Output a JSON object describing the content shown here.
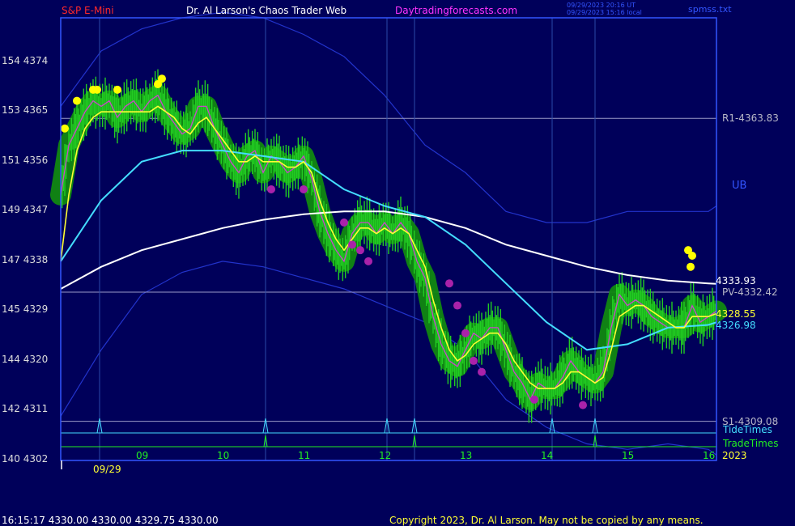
{
  "header": {
    "instrument": "S&P E-Mini",
    "site": "Dr. Al Larson's Chaos Trader Web",
    "url": "Daytradingforecasts.com",
    "stamp_utc": "09/29/2023 20:16 UT",
    "stamp_local": "09/29/2023 15:16 local",
    "file": "spmss.txt"
  },
  "colors": {
    "background": "#00005a",
    "plot_border": "#3355ff",
    "price_bars": "#22cc22",
    "glow": "#118811",
    "fast_avg": "#ffff33",
    "mid_avg": "#44ddff",
    "slow_avg": "#ffffff",
    "bands": "#2233cc",
    "dots_high": "#ffff00",
    "dots_low": "#aa22aa"
  },
  "chart_data": {
    "type": "line",
    "x_label_ticks": [
      "09",
      "10",
      "11",
      "12",
      "13",
      "14",
      "15",
      "16"
    ],
    "x_label_positions_hours": [
      9,
      10,
      11,
      12,
      13,
      14,
      15,
      16
    ],
    "date_label": "09/29",
    "year_label": "2023",
    "xlim": [
      8.0,
      16.1
    ],
    "ylim": [
      4302,
      4382
    ],
    "y_ticks": [
      {
        "label": "154  4374",
        "value": 4374
      },
      {
        "label": "153  4365",
        "value": 4365
      },
      {
        "label": "151  4356",
        "value": 4356
      },
      {
        "label": "149  4347",
        "value": 4347
      },
      {
        "label": "147  4338",
        "value": 4338
      },
      {
        "label": "145  4329",
        "value": 4329
      },
      {
        "label": "144  4320",
        "value": 4320
      },
      {
        "label": "142  4311",
        "value": 4311
      },
      {
        "label": "140  4302",
        "value": 4302
      }
    ],
    "levels": [
      {
        "label": "R1-4363.83",
        "value": 4363.83,
        "color": "#9a9ac8"
      },
      {
        "label": "PV-4332.42",
        "value": 4332.42,
        "color": "#9a9ac8"
      },
      {
        "label": "S1-4309.08",
        "value": 4309.08,
        "color": "#9a9ac8"
      }
    ],
    "band_label": "UB",
    "end_labels": [
      {
        "label": "4333.93",
        "value": 4333.93,
        "color": "#ffffff"
      },
      {
        "label": "4328.55",
        "value": 4328.55,
        "color": "#ffff33"
      },
      {
        "label": "4326.98",
        "value": 4326.98,
        "color": "#44ddff"
      }
    ],
    "price": {
      "name": "",
      "x": [
        8.0,
        8.1,
        8.2,
        8.3,
        8.4,
        8.5,
        8.6,
        8.7,
        8.8,
        8.9,
        9.0,
        9.1,
        9.2,
        9.3,
        9.4,
        9.5,
        9.6,
        9.7,
        9.8,
        9.9,
        10.0,
        10.1,
        10.2,
        10.3,
        10.4,
        10.5,
        10.6,
        10.7,
        10.8,
        10.9,
        11.0,
        11.1,
        11.2,
        11.3,
        11.4,
        11.5,
        11.6,
        11.7,
        11.8,
        11.9,
        12.0,
        12.1,
        12.2,
        12.3,
        12.4,
        12.5,
        12.6,
        12.7,
        12.8,
        12.9,
        13.0,
        13.1,
        13.2,
        13.3,
        13.4,
        13.5,
        13.6,
        13.7,
        13.8,
        13.9,
        14.0,
        14.1,
        14.2,
        14.3,
        14.4,
        14.5,
        14.6,
        14.7,
        14.8,
        14.9,
        15.0,
        15.1,
        15.2,
        15.3,
        15.4,
        15.5,
        15.6,
        15.7,
        15.8,
        15.9,
        16.0,
        16.1
      ],
      "y": [
        4350,
        4359,
        4362,
        4365,
        4367,
        4366,
        4367,
        4364,
        4366,
        4367,
        4365,
        4367,
        4368,
        4365,
        4363,
        4361,
        4362,
        4366,
        4366,
        4362,
        4359,
        4356,
        4354,
        4357,
        4358,
        4354,
        4357,
        4356,
        4354,
        4355,
        4357,
        4353,
        4347,
        4343,
        4340,
        4338,
        4343,
        4345,
        4345,
        4343,
        4345,
        4343,
        4345,
        4343,
        4338,
        4335,
        4328,
        4323,
        4320,
        4319,
        4322,
        4325,
        4324,
        4326,
        4326,
        4322,
        4318,
        4316,
        4313,
        4316,
        4315,
        4315,
        4317,
        4320,
        4318,
        4317,
        4316,
        4318,
        4326,
        4332,
        4330,
        4331,
        4330,
        4328,
        4327,
        4326,
        4326,
        4326,
        4330,
        4327,
        4328,
        4329
      ]
    },
    "fast_avg": {
      "name": "",
      "x": [
        8.0,
        8.1,
        8.2,
        8.3,
        8.4,
        8.5,
        8.6,
        8.7,
        8.8,
        8.9,
        9.0,
        9.1,
        9.2,
        9.3,
        9.4,
        9.5,
        9.6,
        9.7,
        9.8,
        9.9,
        10.0,
        10.1,
        10.2,
        10.3,
        10.4,
        10.5,
        10.6,
        10.7,
        10.8,
        10.9,
        11.0,
        11.1,
        11.2,
        11.3,
        11.4,
        11.5,
        11.6,
        11.7,
        11.8,
        11.9,
        12.0,
        12.1,
        12.2,
        12.3,
        12.4,
        12.5,
        12.6,
        12.7,
        12.8,
        12.9,
        13.0,
        13.1,
        13.2,
        13.3,
        13.4,
        13.5,
        13.6,
        13.7,
        13.8,
        13.9,
        14.0,
        14.1,
        14.2,
        14.3,
        14.4,
        14.5,
        14.6,
        14.7,
        14.8,
        14.9,
        15.0,
        15.1,
        15.2,
        15.3,
        15.4,
        15.5,
        15.6,
        15.7,
        15.8,
        15.9,
        16.0,
        16.1
      ],
      "y": [
        4338,
        4350,
        4358,
        4362,
        4364,
        4365,
        4365,
        4365,
        4365,
        4365,
        4365,
        4365,
        4366,
        4365,
        4364,
        4362,
        4361,
        4363,
        4364,
        4362,
        4360,
        4358,
        4356,
        4356,
        4357,
        4356,
        4356,
        4356,
        4355,
        4355,
        4356,
        4354,
        4349,
        4345,
        4342,
        4340,
        4342,
        4344,
        4344,
        4343,
        4344,
        4343,
        4344,
        4343,
        4340,
        4337,
        4331,
        4326,
        4322,
        4320,
        4321,
        4323,
        4324,
        4325,
        4325,
        4323,
        4320,
        4318,
        4316,
        4315,
        4315,
        4315,
        4316,
        4318,
        4318,
        4317,
        4316,
        4317,
        4322,
        4328,
        4329,
        4330,
        4330,
        4329,
        4328,
        4327,
        4326,
        4326,
        4328,
        4328,
        4328,
        4328.55
      ]
    },
    "mid_avg": {
      "name": "",
      "x": [
        8.0,
        8.5,
        9.0,
        9.5,
        10.0,
        10.5,
        11.0,
        11.5,
        12.0,
        12.5,
        13.0,
        13.5,
        14.0,
        14.5,
        15.0,
        15.5,
        16.0,
        16.1
      ],
      "y": [
        4338,
        4349,
        4356,
        4358,
        4358,
        4357,
        4356,
        4351,
        4348,
        4346,
        4341,
        4334,
        4327,
        4322,
        4323,
        4326,
        4326.5,
        4326.98
      ]
    },
    "slow_avg": {
      "name": "",
      "x": [
        8.0,
        8.5,
        9.0,
        9.5,
        10.0,
        10.5,
        11.0,
        11.5,
        12.0,
        12.5,
        13.0,
        13.5,
        14.0,
        14.5,
        15.0,
        15.5,
        16.0,
        16.1
      ],
      "y": [
        4333,
        4337,
        4340,
        4342,
        4344,
        4345.5,
        4346.5,
        4347,
        4347,
        4346,
        4344,
        4341,
        4339,
        4337,
        4335.5,
        4334.5,
        4334,
        4333.93
      ]
    },
    "upper_band": {
      "name": "",
      "x": [
        8.0,
        8.5,
        9.0,
        9.5,
        10.0,
        10.5,
        11.0,
        11.5,
        12.0,
        12.5,
        13.0,
        13.5,
        14.0,
        14.5,
        15.0,
        15.5,
        16.0,
        16.1
      ],
      "y": [
        4366,
        4376,
        4380,
        4382,
        4383,
        4382,
        4379,
        4375,
        4368,
        4359,
        4354,
        4347,
        4345,
        4345,
        4347,
        4347,
        4347,
        4348
      ]
    },
    "lower_band": {
      "name": "",
      "x": [
        8.0,
        8.5,
        9.0,
        9.5,
        10.0,
        10.5,
        11.0,
        11.5,
        12.0,
        12.5,
        13.0,
        13.5,
        14.0,
        14.5,
        15.0,
        15.5,
        16.0,
        16.1
      ],
      "y": [
        4310,
        4322,
        4332,
        4336,
        4338,
        4337,
        4335,
        4333,
        4330,
        4327,
        4322,
        4313,
        4308,
        4305,
        4304,
        4305,
        4304,
        4303
      ]
    },
    "high_dots": [
      {
        "x": 8.05,
        "y": 4362
      },
      {
        "x": 8.2,
        "y": 4367
      },
      {
        "x": 8.4,
        "y": 4369
      },
      {
        "x": 8.45,
        "y": 4369
      },
      {
        "x": 8.7,
        "y": 4369
      },
      {
        "x": 9.2,
        "y": 4370
      },
      {
        "x": 9.25,
        "y": 4371
      },
      {
        "x": 15.75,
        "y": 4340
      },
      {
        "x": 15.8,
        "y": 4339
      },
      {
        "x": 15.78,
        "y": 4337
      }
    ],
    "low_dots": [
      {
        "x": 10.6,
        "y": 4351
      },
      {
        "x": 11.0,
        "y": 4351
      },
      {
        "x": 11.5,
        "y": 4345
      },
      {
        "x": 11.6,
        "y": 4341
      },
      {
        "x": 11.7,
        "y": 4340
      },
      {
        "x": 11.8,
        "y": 4338
      },
      {
        "x": 12.8,
        "y": 4334
      },
      {
        "x": 12.9,
        "y": 4330
      },
      {
        "x": 13.0,
        "y": 4325
      },
      {
        "x": 13.1,
        "y": 4320
      },
      {
        "x": 13.2,
        "y": 4318
      },
      {
        "x": 13.85,
        "y": 4313
      },
      {
        "x": 14.45,
        "y": 4312
      }
    ],
    "vertical_times": [
      8.48,
      10.53,
      12.03,
      12.37,
      14.07,
      14.6
    ],
    "tide": {
      "label": "TideTimes",
      "spikes": [
        8.48,
        10.53,
        12.03,
        12.37,
        14.07,
        14.6
      ]
    },
    "trade": {
      "label": "TradeTimes",
      "spikes": [
        10.53,
        12.37,
        14.6
      ]
    }
  },
  "footer": {
    "quote": "16:15:17  4330.00 4330.00 4329.75 4330.00",
    "copyright": "Copyright 2023, Dr. Al Larson. May not be copied by any means."
  }
}
